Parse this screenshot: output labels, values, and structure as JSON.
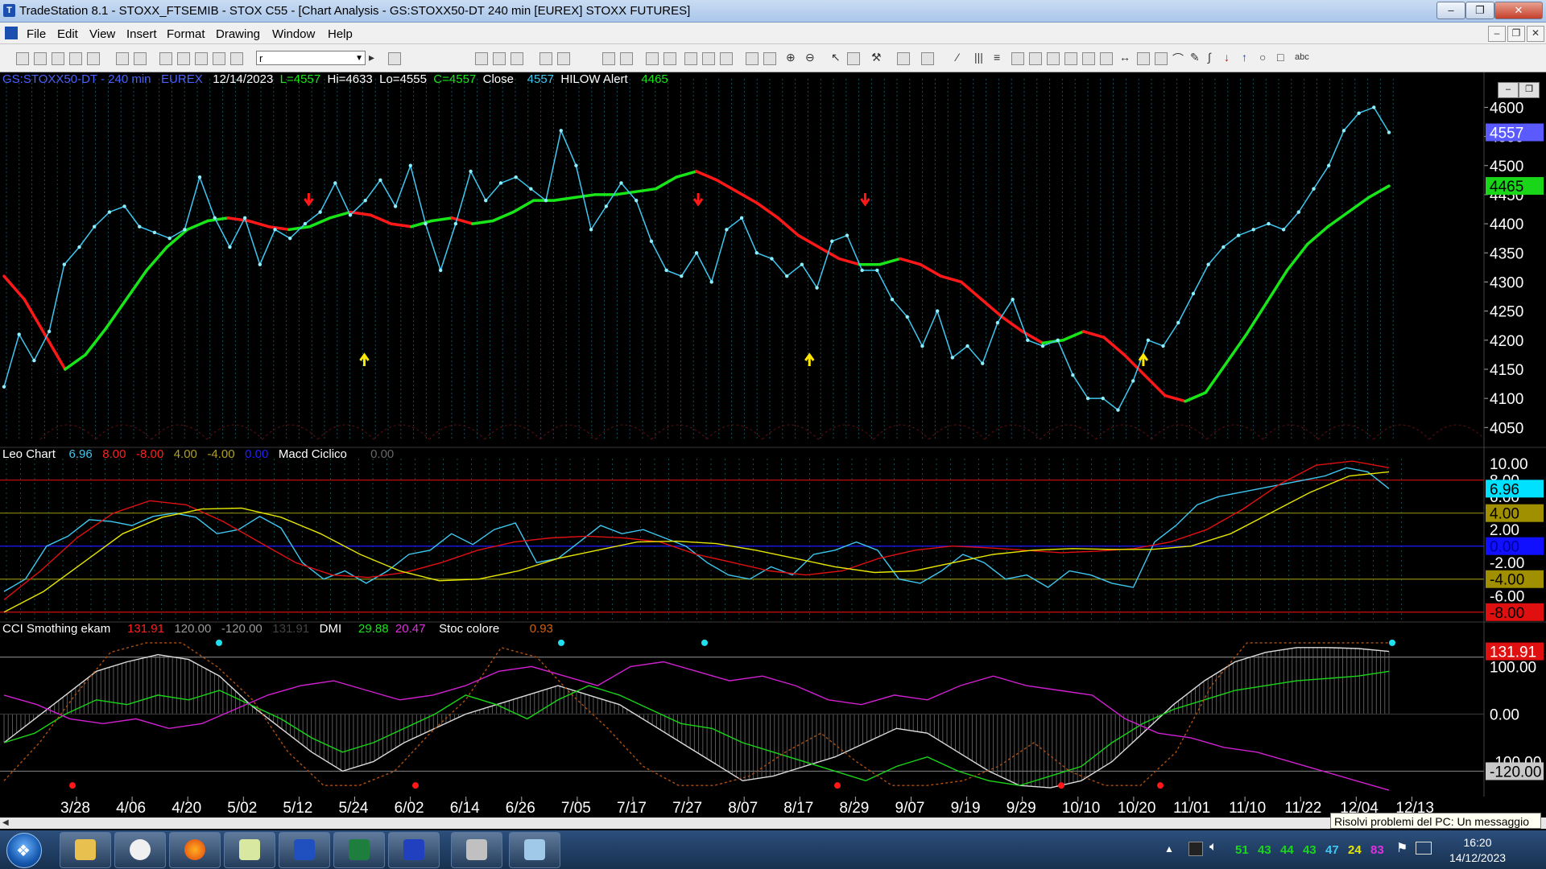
{
  "window": {
    "title": "TradeStation 8.1 - STOXX_FTSEMIB - STOX C55 - [Chart Analysis - GS:STOXX50-DT  240 min  [EUREX] STOXX FUTURES]",
    "minimize_label": "–",
    "restore_label": "❐",
    "close_label": "✕"
  },
  "menu": {
    "items": [
      "File",
      "Edit",
      "View",
      "Insert",
      "Format",
      "Drawing",
      "Window",
      "Help"
    ]
  },
  "toolbar": {
    "combo_value": "r"
  },
  "price_panel": {
    "symbol": "GS:STOXX50-DT - 240 min",
    "exchange": "EUREX",
    "date": "12/14/2023",
    "last": "L=4557",
    "high": "Hi=4633",
    "low": "Lo=4555",
    "close_eq": "C=4557",
    "close_label": "Close",
    "close_value": "4557",
    "alert_label": "HILOW Alert",
    "alert_value": "4465",
    "badge_last": "4557",
    "badge_alert": "4465",
    "axis_labels": [
      "4600",
      "4550",
      "4500",
      "4450",
      "4400",
      "4350",
      "4300",
      "4250",
      "4200",
      "4150",
      "4100",
      "4050"
    ]
  },
  "leo_panel": {
    "name": "Leo Chart",
    "v1": "6.96",
    "v2": "8.00",
    "v3": "-8.00",
    "v4": "4.00",
    "v5": "-4.00",
    "v6": "0.00",
    "macd_label": "Macd Ciclico",
    "macd_value": "0.00",
    "axis_labels": [
      "10.00",
      "8.00",
      "6.00",
      "4.00",
      "2.00",
      "0.00",
      "-2.00",
      "-4.00",
      "-6.00",
      "-8.00"
    ],
    "badges": {
      "cyan": "6.96",
      "olive": "4.00",
      "blue": "0.00",
      "olive2": "-4.00",
      "red": "-8.00"
    }
  },
  "cci_panel": {
    "name": "CCI Smothing ekam",
    "v1": "131.91",
    "v2": "120.00",
    "v3": "-120.00",
    "v4": "131.91",
    "dmi_label": "DMI",
    "dmi_plus": "29.88",
    "dmi_minus": "20.47",
    "stoc_label": "Stoc colore",
    "stoc_value": "0.93",
    "axis_labels": [
      "100.00",
      "0.00",
      "-100.00"
    ],
    "badge_top": "131.91",
    "badge_bottom": "-120.00"
  },
  "chart_data": [
    {
      "type": "line",
      "title": "GS:STOXX50-DT - 240 min",
      "x_tick_labels": [
        "3/28",
        "4/06",
        "4/20",
        "5/02",
        "5/12",
        "5/24",
        "6/02",
        "6/14",
        "6/26",
        "7/05",
        "7/17",
        "7/27",
        "8/07",
        "8/17",
        "8/29",
        "9/07",
        "9/19",
        "9/29",
        "10/10",
        "10/20",
        "11/01",
        "11/10",
        "11/22",
        "12/04",
        "12/13"
      ],
      "ylim": [
        4020,
        4660
      ],
      "series": [
        {
          "name": "Close",
          "color": "#3ec8f0",
          "values": [
            4120,
            4210,
            4165,
            4215,
            4330,
            4360,
            4395,
            4420,
            4430,
            4395,
            4385,
            4375,
            4390,
            4480,
            4410,
            4360,
            4410,
            4330,
            4390,
            4375,
            4400,
            4420,
            4470,
            4415,
            4440,
            4475,
            4430,
            4500,
            4400,
            4320,
            4400,
            4490,
            4440,
            4470,
            4480,
            4460,
            4440,
            4560,
            4500,
            4390,
            4430,
            4470,
            4440,
            4370,
            4320,
            4310,
            4350,
            4300,
            4390,
            4410,
            4350,
            4340,
            4310,
            4330,
            4290,
            4370,
            4380,
            4320,
            4320,
            4270,
            4240,
            4190,
            4250,
            4170,
            4190,
            4160,
            4230,
            4270,
            4200,
            4190,
            4200,
            4140,
            4100,
            4100,
            4080,
            4130,
            4200,
            4190,
            4230,
            4280,
            4330,
            4360,
            4380,
            4390,
            4400,
            4390,
            4420,
            4460,
            4500,
            4560,
            4590,
            4600,
            4557
          ]
        },
        {
          "name": "HILOW Alert",
          "colors": [
            "#ff1818",
            "#19e619"
          ],
          "values": [
            4310,
            4270,
            4210,
            4150,
            4175,
            4220,
            4270,
            4320,
            4360,
            4390,
            4405,
            4410,
            4405,
            4395,
            4390,
            4395,
            4410,
            4420,
            4415,
            4400,
            4395,
            4405,
            4410,
            4400,
            4405,
            4420,
            4440,
            4440,
            4445,
            4450,
            4450,
            4455,
            4460,
            4480,
            4490,
            4475,
            4455,
            4435,
            4410,
            4380,
            4360,
            4340,
            4330,
            4330,
            4340,
            4330,
            4310,
            4300,
            4270,
            4240,
            4215,
            4195,
            4200,
            4215,
            4205,
            4175,
            4140,
            4105,
            4095,
            4110,
            4160,
            4210,
            4265,
            4320,
            4365,
            4395,
            4420,
            4445,
            4465
          ]
        }
      ],
      "arrows": [
        {
          "date": "5/12",
          "dir": "down",
          "color": "red"
        },
        {
          "date": "5/24",
          "dir": "up",
          "color": "yellow"
        },
        {
          "date": "7/27",
          "dir": "down",
          "color": "red"
        },
        {
          "date": "8/17",
          "dir": "up",
          "color": "yellow"
        },
        {
          "date": "8/29",
          "dir": "down",
          "color": "red"
        },
        {
          "date": "10/20",
          "dir": "up",
          "color": "yellow"
        }
      ]
    },
    {
      "type": "line",
      "title": "Leo Chart",
      "ylim": [
        -8.9,
        10.6
      ],
      "series": [
        {
          "name": "Macd Ciclico",
          "color": "#3ec8f0",
          "values": [
            -5.5,
            -4.0,
            0.0,
            1.2,
            3.2,
            3.0,
            2.5,
            3.6,
            4.0,
            3.5,
            1.5,
            2.0,
            3.6,
            2.2,
            -2.0,
            -4.0,
            -3.0,
            -4.5,
            -3.0,
            -1.0,
            -0.5,
            1.5,
            0.2,
            2.0,
            2.8,
            -2.0,
            -1.5,
            0.5,
            2.5,
            1.5,
            2.0,
            1.0,
            0.0,
            -2.0,
            -3.5,
            -4.0,
            -2.5,
            -3.5,
            -1.0,
            -0.5,
            0.5,
            -0.5,
            -4.0,
            -4.5,
            -3.0,
            -1.0,
            -2.0,
            -4.0,
            -3.5,
            -5.0,
            -3.0,
            -3.5,
            -4.5,
            -5.0,
            0.5,
            2.5,
            5.0,
            6.0,
            6.5,
            7.0,
            7.5,
            8.0,
            8.5,
            9.5,
            9.0,
            6.96
          ]
        },
        {
          "name": "",
          "color": "#e01010",
          "values": [
            -6.5,
            -3.0,
            1.0,
            4.0,
            5.5,
            5.0,
            3.0,
            0.5,
            -2.0,
            -3.5,
            -3.8,
            -3.2,
            -2.0,
            -0.5,
            0.5,
            1.0,
            1.2,
            1.0,
            0.5,
            -1.0,
            -2.0,
            -3.0,
            -3.5,
            -3.0,
            -1.5,
            -0.5,
            0.0,
            -0.2,
            -0.5,
            -0.8,
            -0.6,
            -0.3,
            0.5,
            2.0,
            4.5,
            7.5,
            9.8,
            10.3,
            9.5
          ]
        },
        {
          "name": "",
          "color": "#e6e600",
          "values": [
            -8.0,
            -5.5,
            -2.0,
            1.5,
            3.5,
            4.5,
            4.6,
            3.5,
            1.5,
            -1.0,
            -3.0,
            -4.2,
            -4.0,
            -3.0,
            -1.5,
            -0.5,
            0.5,
            0.6,
            0.3,
            -0.5,
            -1.5,
            -2.5,
            -3.2,
            -3.0,
            -2.0,
            -1.0,
            -0.5,
            -0.3,
            -0.4,
            -0.4,
            0.0,
            1.5,
            4.0,
            6.5,
            8.5,
            9.0
          ]
        }
      ]
    },
    {
      "type": "line",
      "title": "CCI Smothing ekam",
      "ylim": [
        -170,
        165
      ],
      "series": [
        {
          "name": "CCI Smothing ekam",
          "color": "#dcdcdc",
          "values": [
            -60,
            -10,
            40,
            90,
            110,
            125,
            115,
            80,
            20,
            -30,
            -80,
            -120,
            -100,
            -60,
            -30,
            0,
            20,
            40,
            60,
            40,
            20,
            -20,
            -60,
            -100,
            -140,
            -130,
            -110,
            -90,
            -60,
            -30,
            -40,
            -80,
            -120,
            -150,
            -155,
            -140,
            -100,
            -40,
            20,
            70,
            110,
            130,
            140,
            140,
            138,
            131.91
          ]
        },
        {
          "name": "DMI",
          "color": "#19d619",
          "values": [
            -60,
            -40,
            0,
            30,
            20,
            40,
            30,
            50,
            20,
            -10,
            -50,
            -80,
            -60,
            -30,
            0,
            40,
            20,
            -10,
            30,
            60,
            40,
            10,
            -20,
            -30,
            -60,
            -80,
            -100,
            -120,
            -140,
            -110,
            -90,
            -120,
            -140,
            -150,
            -130,
            -110,
            -60,
            -20,
            10,
            30,
            50,
            60,
            70,
            75,
            80,
            90
          ]
        },
        {
          "name": "",
          "color": "#d020d0",
          "values": [
            40,
            20,
            -10,
            -20,
            -10,
            -30,
            -20,
            10,
            40,
            60,
            70,
            50,
            30,
            40,
            60,
            90,
            100,
            80,
            60,
            100,
            110,
            90,
            70,
            80,
            60,
            30,
            20,
            40,
            30,
            60,
            80,
            60,
            50,
            40,
            -10,
            -40,
            -50,
            -70,
            -80,
            -100,
            -120,
            -140,
            -160
          ]
        },
        {
          "name": "Stoc colore",
          "color": "#b05010",
          "values": [
            -140,
            -60,
            40,
            130,
            150,
            150,
            100,
            30,
            -80,
            -150,
            -150,
            -120,
            -40,
            30,
            140,
            120,
            40,
            -30,
            -110,
            -150,
            -150,
            -130,
            -80,
            -40,
            -100,
            -150,
            -150,
            -140,
            -110,
            -60,
            -120,
            -150,
            -150,
            -80,
            60,
            150,
            150,
            150,
            150,
            150
          ]
        }
      ]
    }
  ]
}
